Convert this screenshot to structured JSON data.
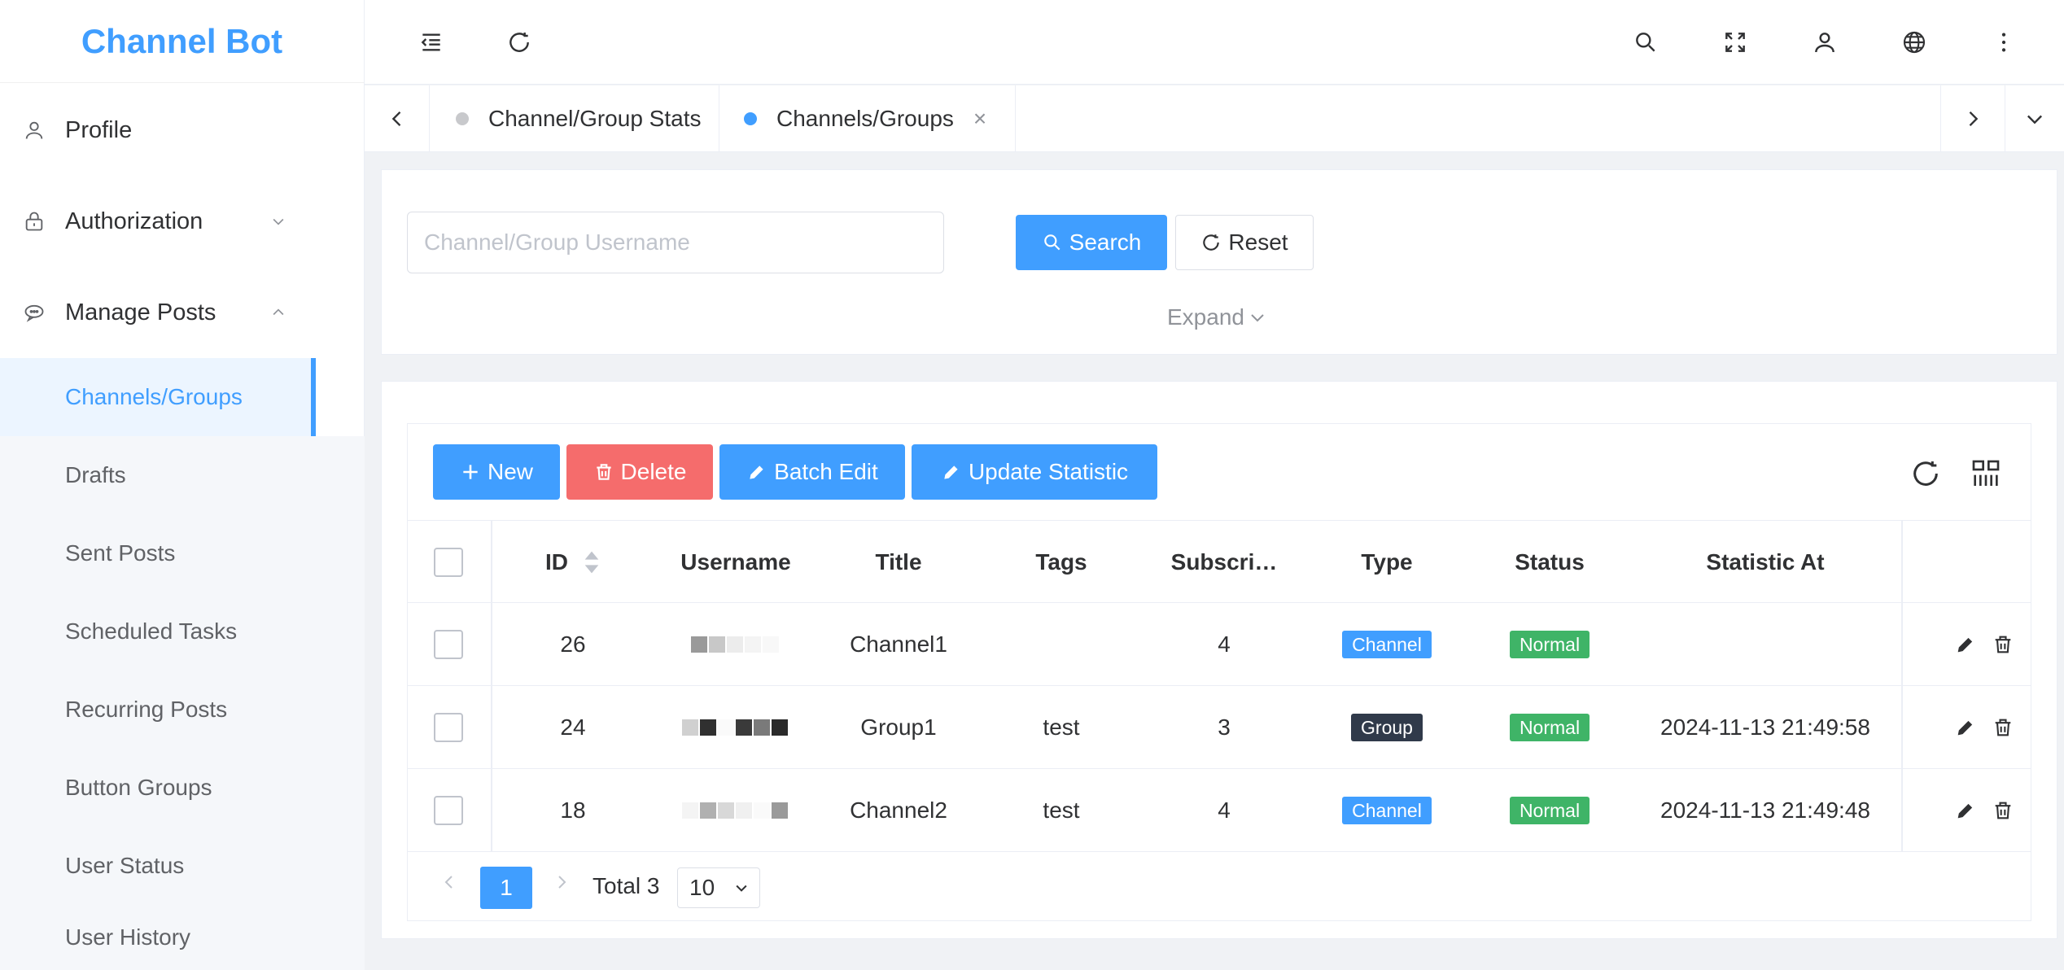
{
  "app": {
    "title": "Channel Bot"
  },
  "sidebar": {
    "items": [
      {
        "label": "Profile",
        "icon": "user-icon"
      },
      {
        "label": "Authorization",
        "icon": "lock-icon"
      },
      {
        "label": "Manage Posts",
        "icon": "chat-icon"
      }
    ],
    "subitems": [
      {
        "label": "Channels/Groups",
        "active": true
      },
      {
        "label": "Drafts"
      },
      {
        "label": "Sent Posts"
      },
      {
        "label": "Scheduled Tasks"
      },
      {
        "label": "Recurring Posts"
      },
      {
        "label": "Button Groups"
      },
      {
        "label": "User Status"
      },
      {
        "label": "User History"
      }
    ]
  },
  "tabs": [
    {
      "label": "Channel/Group Stats",
      "dot_color": "#c8c9cc"
    },
    {
      "label": "Channels/Groups",
      "dot_color": "#409eff",
      "close": "×"
    }
  ],
  "search": {
    "placeholder": "Channel/Group Username",
    "search_label": "Search",
    "reset_label": "Reset",
    "expand_label": "Expand"
  },
  "toolbar": {
    "new_label": "New",
    "delete_label": "Delete",
    "batch_edit_label": "Batch Edit",
    "update_statistic_label": "Update Statistic"
  },
  "table": {
    "columns": [
      "ID",
      "Username",
      "Title",
      "Tags",
      "Subscri…",
      "Type",
      "Status",
      "Statistic At"
    ],
    "rows": [
      {
        "id": "26",
        "title": "Channel1",
        "tags": "",
        "subscribers": "4",
        "type": "Channel",
        "status": "Normal",
        "statistic_at": ""
      },
      {
        "id": "24",
        "title": "Group1",
        "tags": "test",
        "subscribers": "3",
        "type": "Group",
        "status": "Normal",
        "statistic_at": "2024-11-13 21:49:58"
      },
      {
        "id": "18",
        "title": "Channel2",
        "tags": "test",
        "subscribers": "4",
        "type": "Channel",
        "status": "Normal",
        "statistic_at": "2024-11-13 21:49:48"
      }
    ]
  },
  "pagination": {
    "current_page": "1",
    "total_label": "Total 3",
    "page_size": "10"
  },
  "colors": {
    "primary": "#409eff",
    "danger": "#f56c6c",
    "success": "#3fb467",
    "dark_tag": "#303a4a"
  }
}
